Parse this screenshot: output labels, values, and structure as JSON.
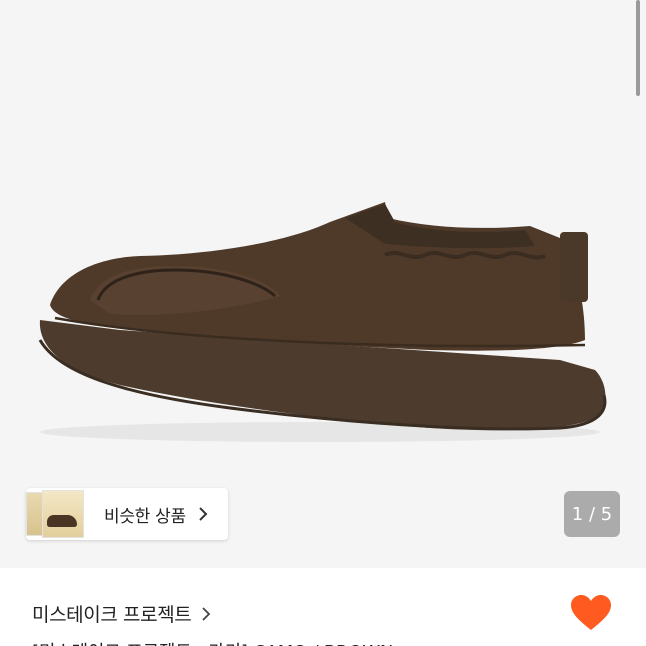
{
  "similar_products": {
    "label": "비슷한 상품"
  },
  "gallery": {
    "current": 1,
    "total": 5,
    "indicator": "1 / 5"
  },
  "product": {
    "shop_name": "미스테이크 프로젝트",
    "title": "[미스테이크 프로젝트 · 카키] CAMO / BROWN"
  },
  "colors": {
    "accent": "#ff5a1f",
    "shoe_brown": "#4f3a2a",
    "sole": "#4d3c2e"
  },
  "icons": [
    "chevron-right-icon",
    "heart-icon"
  ]
}
